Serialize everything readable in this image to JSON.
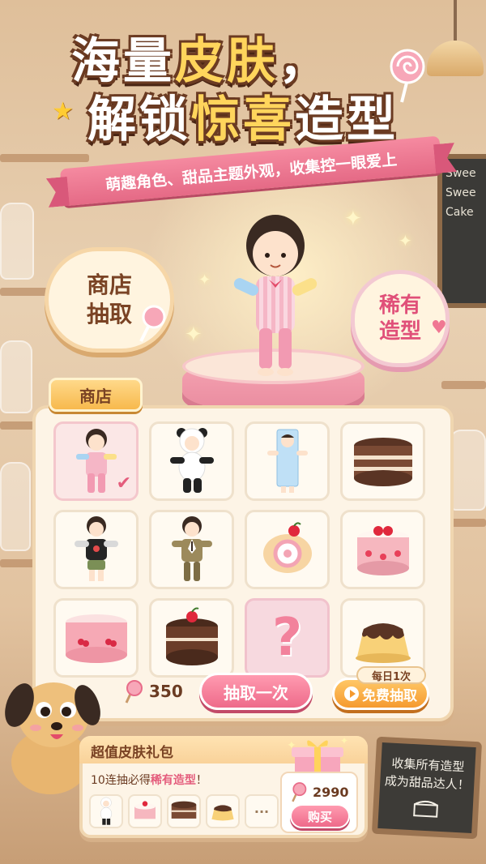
{
  "title": {
    "line1_a": "海量",
    "line1_b": "皮肤",
    "line1_c": "，",
    "line2_a": "解锁",
    "line2_b": "惊喜",
    "line2_c": "造型"
  },
  "subtitle": "萌趣角色、甜品主题外观，收集控一眼爱上",
  "badges": {
    "shop_draw_line1": "商店",
    "shop_draw_line2": "抽取",
    "rare_line1": "稀有",
    "rare_line2": "造型"
  },
  "shop": {
    "tab_label": "商店",
    "items": [
      {
        "name": "pajama-outfit",
        "selected": true
      },
      {
        "name": "panda-outfit"
      },
      {
        "name": "milk-carton-outfit"
      },
      {
        "name": "chocolate-layer-cake"
      },
      {
        "name": "black-tshirt-outfit"
      },
      {
        "name": "suit-outfit"
      },
      {
        "name": "strawberry-roll-cake"
      },
      {
        "name": "strawberry-cake"
      },
      {
        "name": "cherry-roll-cake"
      },
      {
        "name": "chocolate-cherry-cake"
      },
      {
        "name": "mystery",
        "symbol": "?"
      },
      {
        "name": "pudding"
      }
    ],
    "currency_amount": "350",
    "draw_once_label": "抽取一次",
    "daily_tag": "每日1次",
    "free_draw_label": "免费抽取"
  },
  "bundle": {
    "title": "超值皮肤礼包",
    "desc_a": "10连抽必得",
    "desc_b": "稀有造型",
    "desc_c": "！",
    "more": "···",
    "price": "2990",
    "buy_label": "购买"
  },
  "chalkboard": {
    "line1": "收集所有造型",
    "line2": "成为甜品达人！"
  },
  "background_board": {
    "line1": "Swee",
    "line2": "Swee",
    "line3": "Cake"
  },
  "colors": {
    "brand_pink": "#ee6a8a",
    "brand_orange": "#f59a2f",
    "title_brown": "#6b3b22",
    "title_yellow": "#ffd55c",
    "panel_cream": "#fdf4e6"
  }
}
